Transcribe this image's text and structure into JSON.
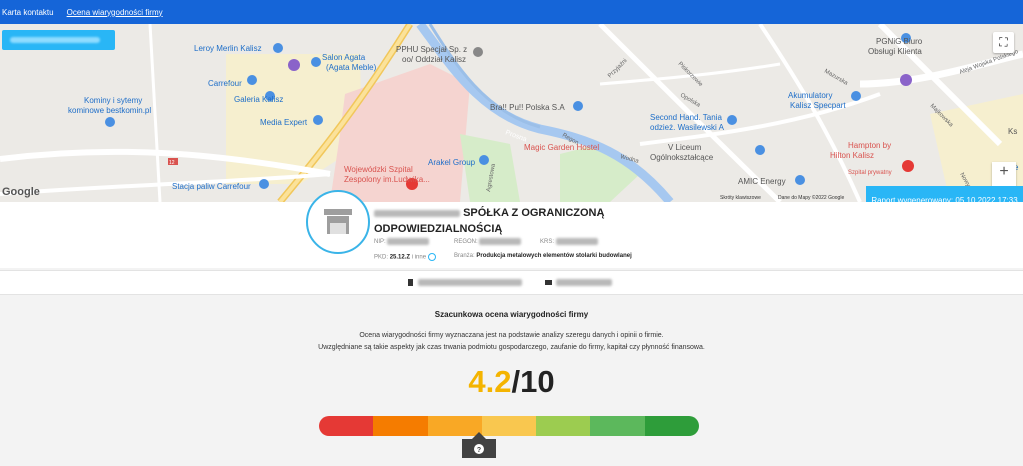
{
  "nav": {
    "items": [
      {
        "label": "Karta kontaktu"
      },
      {
        "label": "Ocena wiarygodności firmy"
      }
    ]
  },
  "map": {
    "labels": [
      {
        "text": "Leroy Merlin Kalisz"
      },
      {
        "text": "Salon Agata"
      },
      {
        "text": "(Agata Meble)"
      },
      {
        "text": "Carrefour"
      },
      {
        "text": "Galeria Kalisz"
      },
      {
        "text": "Kominy i sytemy"
      },
      {
        "text": "kominowe bestkomin.pl"
      },
      {
        "text": "Media Expert"
      },
      {
        "text": "Stacja paliw Carrefour"
      },
      {
        "text": "Wojewódzki Szpital"
      },
      {
        "text": "Zespolony im.Ludwika..."
      },
      {
        "text": "Arakel Group"
      },
      {
        "text": "Magic Garden Hostel"
      },
      {
        "text": "PPHU Specjał Sp. z"
      },
      {
        "text": "oo/ Oddział Kalisz"
      },
      {
        "text": "Bra!! Pu!! Polska S.A"
      },
      {
        "text": "Second Hand. Tania"
      },
      {
        "text": "odzież. Wasilewski A"
      },
      {
        "text": "Akumulatory"
      },
      {
        "text": "Kalisz Specpart"
      },
      {
        "text": "V Liceum"
      },
      {
        "text": "Ogólnokształcące"
      },
      {
        "text": "AMIC Energy"
      },
      {
        "text": "PGNiG Biuro"
      },
      {
        "text": "Obsługi Klienta"
      },
      {
        "text": "Hampton by"
      },
      {
        "text": "Hilton Kalisz"
      },
      {
        "text": "Szpital prywatny"
      },
      {
        "text": "Prosna"
      },
      {
        "text": "Przyjaźni"
      },
      {
        "text": "Piskorzewie"
      },
      {
        "text": "Opolska"
      },
      {
        "text": "Regon"
      },
      {
        "text": "Wodna"
      },
      {
        "text": "Mazurska"
      },
      {
        "text": "Aleja Wojska Polskiego"
      },
      {
        "text": "Majkowska"
      },
      {
        "text": "Agrestowa"
      },
      {
        "text": "Nowy Rynek"
      },
      {
        "text": "Te"
      },
      {
        "text": "Ks"
      }
    ],
    "road_number": "12",
    "google": "Google",
    "shortcuts": "Skróty klawiszowe",
    "map_data": "Dane do Mapy ©2022 Google",
    "fullscreen_icon": "⛶",
    "zoom_in": "+",
    "zoom_out": "−"
  },
  "report": {
    "label": "Raport wygenerowany: 05.10.2022 17:33"
  },
  "company": {
    "name_line1": "SPÓŁKA Z OGRANICZONĄ",
    "name_line2": "ODPOWIEDZIALNOŚCIĄ",
    "nip_label": "NIP:",
    "regon_label": "REGON:",
    "krs_label": "KRS:",
    "pkd_label": "PKD:",
    "pkd_value": "25.12.Z",
    "pkd_more": "i inne",
    "branza_label": "Branża:",
    "branza_value": "Produkcja metalowych elementów stolarki budowlanej"
  },
  "rating": {
    "heading": "Szacunkowa ocena wiarygodności firmy",
    "desc_line1": "Ocena wiarygodności firmy wyznaczana jest na podstawie analizy szeregu danych i opinii o firmie.",
    "desc_line2": "Uwzględniane są takie aspekty jak czas trwania podmiotu gospodarczego, zaufanie do firmy, kapitał czy płynność finansowa.",
    "value": "4.2",
    "max": "/10",
    "score_fraction": 0.42,
    "scale_colors": [
      "#e53935",
      "#f57c00",
      "#f9a825",
      "#f9c74f",
      "#9ccc50",
      "#5cb85c",
      "#2e9d3a"
    ],
    "help_icon": "?"
  }
}
